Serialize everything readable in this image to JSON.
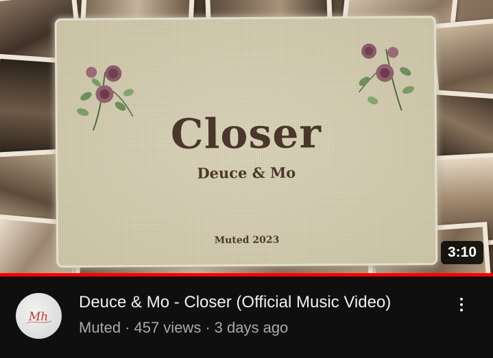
{
  "thumbnail": {
    "title_art": "Closer",
    "artist_art": "Deuce & Mo",
    "footer_art": "Muted 2023",
    "duration": "3:10",
    "watch_progress": 1.0,
    "progress_color": "#ff0000"
  },
  "video": {
    "title": "Deuce & Mo - Closer (Official Music Video)",
    "channel": "Muted",
    "views": "457 views",
    "age": "3 days ago",
    "separator": "·"
  },
  "channel_avatar": {
    "logo_text": "Mh",
    "logo_color": "#c0392b"
  },
  "icons": {
    "menu": "more-vert-icon"
  }
}
